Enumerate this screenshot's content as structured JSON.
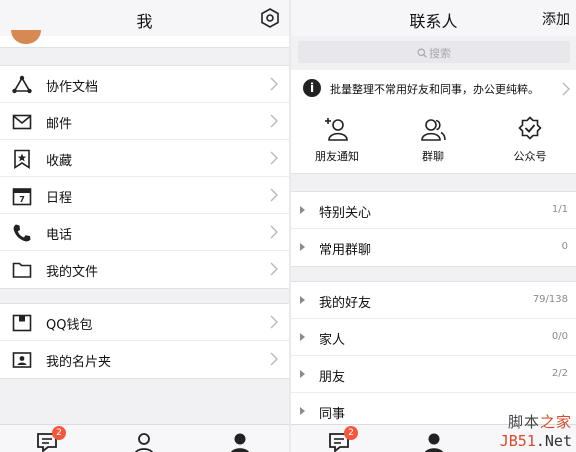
{
  "me": {
    "title": "我",
    "settings_icon": "settings-icon",
    "group1": [
      {
        "label": "协作文档",
        "icon": "collab-doc-icon"
      },
      {
        "label": "邮件",
        "icon": "mail-icon"
      },
      {
        "label": "收藏",
        "icon": "bookmark-icon"
      },
      {
        "label": "日程",
        "icon": "calendar-icon"
      },
      {
        "label": "电话",
        "icon": "phone-icon"
      },
      {
        "label": "我的文件",
        "icon": "folder-icon"
      }
    ],
    "group2": [
      {
        "label": "QQ钱包",
        "icon": "wallet-icon"
      },
      {
        "label": "我的名片夹",
        "icon": "card-holder-icon"
      }
    ],
    "tabbar": {
      "badge": "2"
    }
  },
  "contacts": {
    "title": "联系人",
    "add_label": "添加",
    "search_placeholder": "搜索",
    "notice": "批量整理不常用好友和同事，办公更纯粹。",
    "actions": [
      {
        "label": "朋友通知",
        "icon": "friend-notify-icon"
      },
      {
        "label": "群聊",
        "icon": "group-chat-icon"
      },
      {
        "label": "公众号",
        "icon": "official-account-icon"
      }
    ],
    "group1": [
      {
        "label": "特别关心",
        "count": "1/1"
      },
      {
        "label": "常用群聊",
        "count": "0"
      }
    ],
    "group2": [
      {
        "label": "我的好友",
        "count": "79/138"
      },
      {
        "label": "家人",
        "count": "0/0"
      },
      {
        "label": "朋友",
        "count": "2/2"
      },
      {
        "label": "同事",
        "count": ""
      }
    ],
    "tabbar": {
      "badge": "2"
    }
  },
  "watermark": {
    "line1_a": "脚本",
    "line1_b": "之家",
    "line2_a": "JB51",
    "line2_b": ".Net"
  }
}
